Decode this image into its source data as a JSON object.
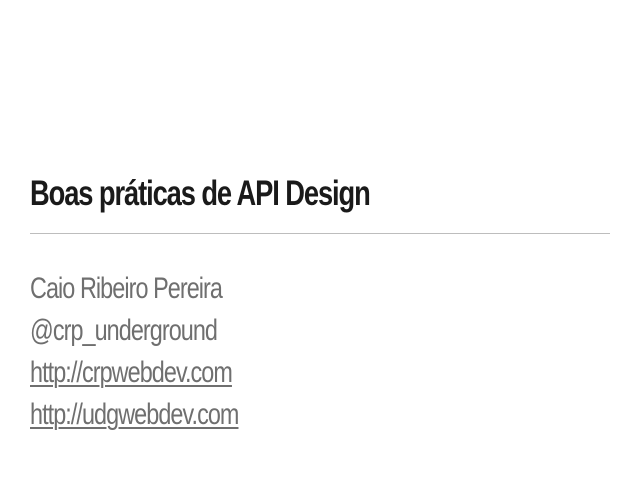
{
  "slide": {
    "title": "Boas práticas de API Design",
    "author_name": "Caio Ribeiro Pereira",
    "handle": "@crp_underground",
    "links": [
      "http://crpwebdev.com",
      "http://udgwebdev.com"
    ]
  },
  "colors": {
    "background": "#ffffff",
    "title": "#1a1a1a",
    "body_text": "#6f6f6f",
    "divider": "#bdbdbd"
  }
}
